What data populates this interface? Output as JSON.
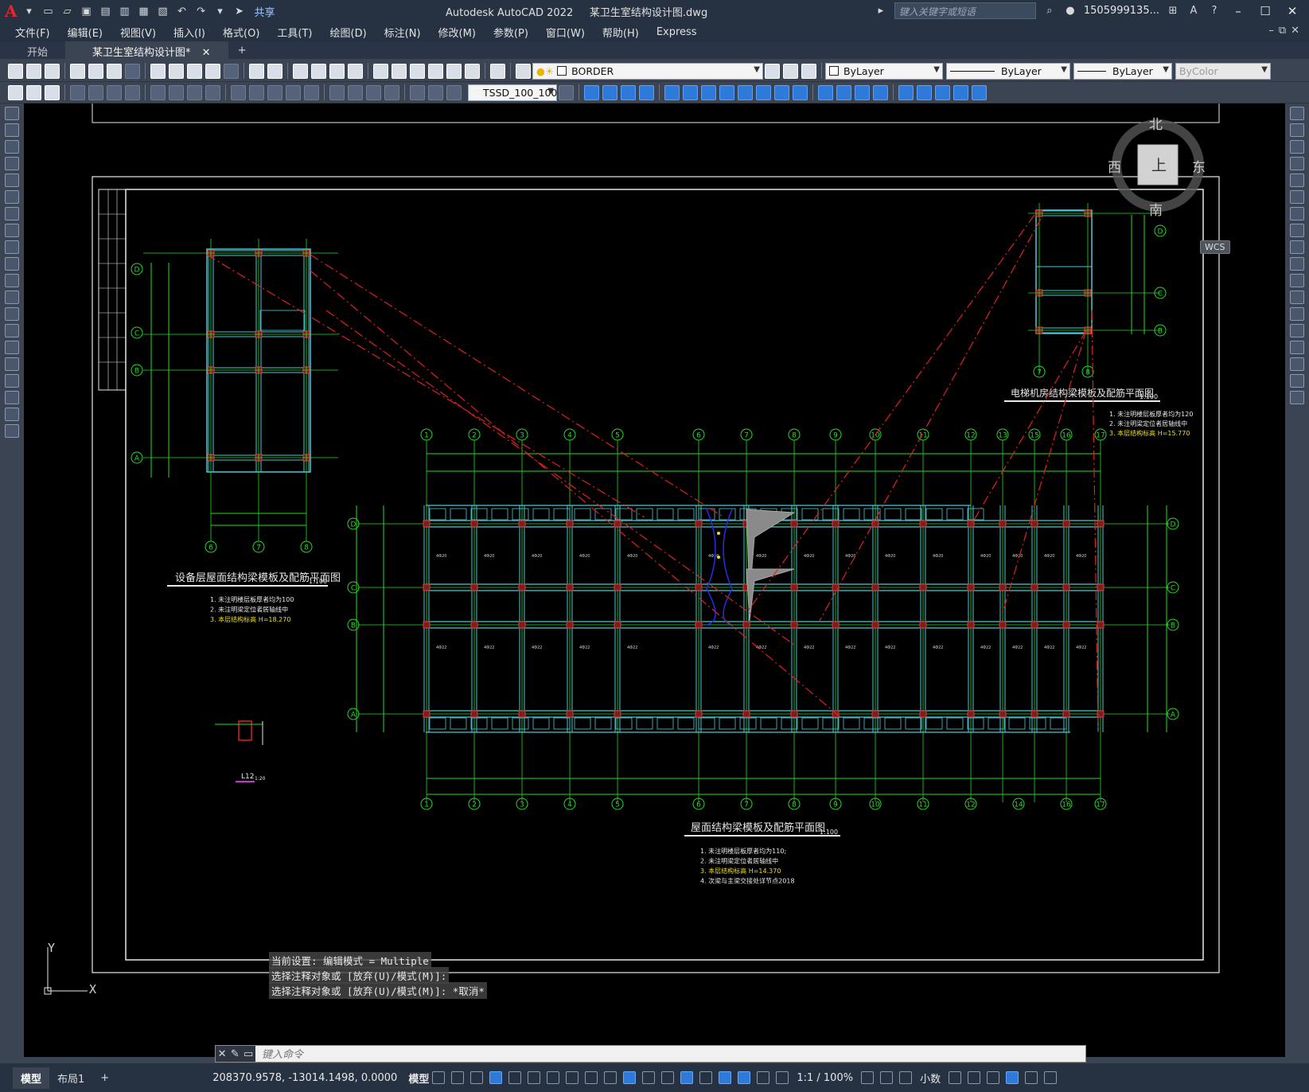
{
  "window": {
    "app_title": "Autodesk AutoCAD 2022",
    "file_title": "某卫生室结构设计图.dwg",
    "search_placeholder": "键入关键字或短语",
    "user": "1505999135...",
    "share": "共享"
  },
  "menu": [
    "文件(F)",
    "编辑(E)",
    "视图(V)",
    "插入(I)",
    "格式(O)",
    "工具(T)",
    "绘图(D)",
    "标注(N)",
    "修改(M)",
    "参数(P)",
    "窗口(W)",
    "帮助(H)",
    "Express"
  ],
  "tabs": {
    "start": "开始",
    "active": "某卫生室结构设计图*"
  },
  "toolbar": {
    "layer": "BORDER",
    "color": "ByLayer",
    "linetype": "ByLayer",
    "lineweight": "ByLayer",
    "plotstyle": "ByColor",
    "dimstyle": "TSSD_100_100"
  },
  "viewcube": {
    "north": "北",
    "south": "南",
    "west": "西",
    "east": "东",
    "top": "上",
    "wcs": "WCS"
  },
  "drawing": {
    "plan_left_title": "设备层屋面结构梁模板及配筋平面图",
    "plan_left_scale": "1:100",
    "plan_left_notes": [
      "1. 未注明楼层板厚者均为100",
      "2. 未注明梁定位者居轴线中",
      "3. 本层结构标高  H=18.270"
    ],
    "plan_right_title": "电梯机房结构梁模板及配筋平面图",
    "plan_right_scale": "1:100",
    "plan_right_notes": [
      "1. 未注明楼层板厚者均为120",
      "2. 未注明梁定位者居轴线中",
      "3. 本层结构标高  H=15.770"
    ],
    "plan_main_title": "屋面结构梁模板及配筋平面图",
    "plan_main_scale": "1:100",
    "plan_main_notes": [
      "1. 未注明楼层板厚者均为110;",
      "2. 未注明梁定位者居轴线中",
      "3. 本层结构标高  H=14.370",
      "4. 次梁与主梁交接处详节点2018"
    ],
    "detail_label": "L12",
    "detail_scale": "1:20",
    "axis_top_main": [
      "1",
      "2",
      "3",
      "4",
      "5",
      "6",
      "7",
      "8",
      "9",
      "10",
      "11",
      "12",
      "13",
      "15",
      "16",
      "17"
    ],
    "axis_bottom_main": [
      "1",
      "2",
      "3",
      "4",
      "5",
      "6",
      "7",
      "8",
      "9",
      "10",
      "11",
      "12",
      "14",
      "16",
      "17"
    ],
    "axis_rows_main": [
      "D",
      "C",
      "B",
      "A"
    ],
    "axis_left_small": [
      "D",
      "C",
      "B",
      "A"
    ],
    "axis_left_small_bottom": [
      "6",
      "7",
      "8"
    ],
    "axis_right_small_rows": [
      "D",
      "C",
      "B"
    ],
    "axis_right_small_bottom": [
      "7",
      "8"
    ],
    "ucs_y": "Y",
    "ucs_x": "X"
  },
  "command_history": [
    "当前设置: 编辑模式 = Multiple",
    "选择注释对象或 [放弃(U)/模式(M)]:",
    "选择注释对象或 [放弃(U)/模式(M)]: *取消*"
  ],
  "command_placeholder": "键入命令",
  "layouts": {
    "model": "模型",
    "layout1": "布局1"
  },
  "status": {
    "coords": "208370.9578, -13014.1498, 0.0000",
    "model": "模型",
    "scale": "1:1 / 100%",
    "units": "小数"
  }
}
